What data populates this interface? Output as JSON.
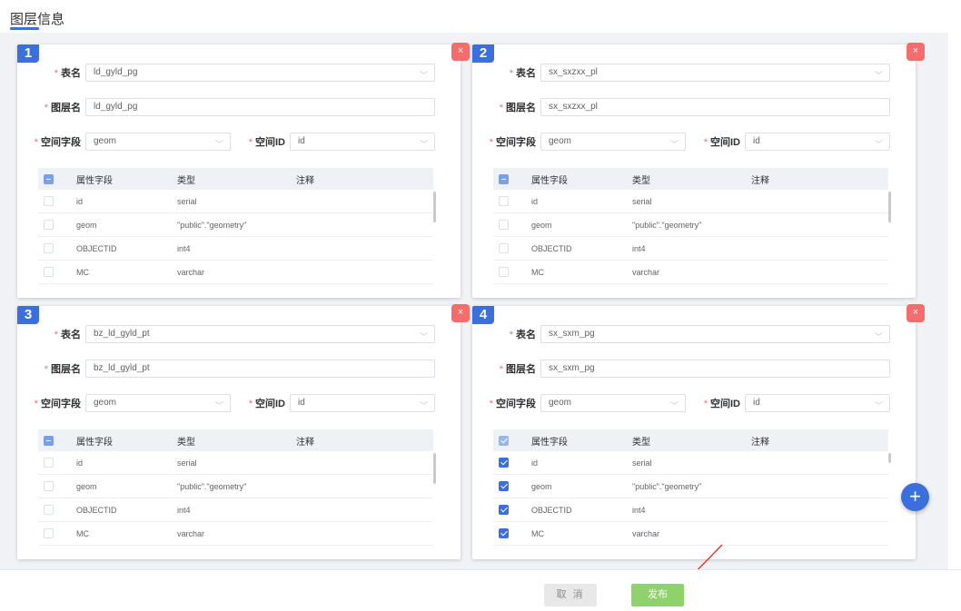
{
  "page": {
    "title": "图层信息"
  },
  "labels": {
    "table_name": "表名",
    "layer_name": "图层名",
    "spatial_field": "空间字段",
    "spatial_id": "空间ID",
    "required_mark": "*",
    "col_attr": "属性字段",
    "col_type": "类型",
    "col_note": "注释",
    "close_icon": "×",
    "chevron_icon": "﹀"
  },
  "cards": [
    {
      "num": "1",
      "table_name": "ld_gyld_pg",
      "layer_name": "ld_gyld_pg",
      "spatial_field": "geom",
      "spatial_id": "id",
      "header_check": "indeterminate",
      "rows": [
        {
          "field": "id",
          "type": "serial",
          "note": "",
          "checked": false
        },
        {
          "field": "geom",
          "type": "\"public\".\"geometry\"",
          "note": "",
          "checked": false
        },
        {
          "field": "OBJECTID",
          "type": "int4",
          "note": "",
          "checked": false
        },
        {
          "field": "MC",
          "type": "varchar",
          "note": "",
          "checked": false
        }
      ]
    },
    {
      "num": "2",
      "table_name": "sx_sxzxx_pl",
      "layer_name": "sx_sxzxx_pl",
      "spatial_field": "geom",
      "spatial_id": "id",
      "header_check": "indeterminate",
      "rows": [
        {
          "field": "id",
          "type": "serial",
          "note": "",
          "checked": false
        },
        {
          "field": "geom",
          "type": "\"public\".\"geometry\"",
          "note": "",
          "checked": false
        },
        {
          "field": "OBJECTID",
          "type": "int4",
          "note": "",
          "checked": false
        },
        {
          "field": "MC",
          "type": "varchar",
          "note": "",
          "checked": false
        }
      ]
    },
    {
      "num": "3",
      "table_name": "bz_ld_gyld_pt",
      "layer_name": "bz_ld_gyld_pt",
      "spatial_field": "geom",
      "spatial_id": "id",
      "header_check": "indeterminate",
      "rows": [
        {
          "field": "id",
          "type": "serial",
          "note": "",
          "checked": false
        },
        {
          "field": "geom",
          "type": "\"public\".\"geometry\"",
          "note": "",
          "checked": false
        },
        {
          "field": "OBJECTID",
          "type": "int4",
          "note": "",
          "checked": false
        },
        {
          "field": "MC",
          "type": "varchar",
          "note": "",
          "checked": false
        }
      ]
    },
    {
      "num": "4",
      "table_name": "sx_sxm_pg",
      "layer_name": "sx_sxm_pg",
      "spatial_field": "geom",
      "spatial_id": "id",
      "header_check": "checked",
      "rows": [
        {
          "field": "id",
          "type": "serial",
          "note": "",
          "checked": true
        },
        {
          "field": "geom",
          "type": "\"public\".\"geometry\"",
          "note": "",
          "checked": true
        },
        {
          "field": "OBJECTID",
          "type": "int4",
          "note": "",
          "checked": true
        },
        {
          "field": "MC",
          "type": "varchar",
          "note": "",
          "checked": true
        }
      ]
    }
  ],
  "fab": {
    "icon": "+"
  },
  "footer": {
    "cancel_label": "取 消",
    "publish_label": "发布"
  },
  "colors": {
    "primary": "#3b6fdc",
    "danger": "#f56c6c",
    "success": "#8fd16a",
    "arrow": "#e8332a"
  }
}
